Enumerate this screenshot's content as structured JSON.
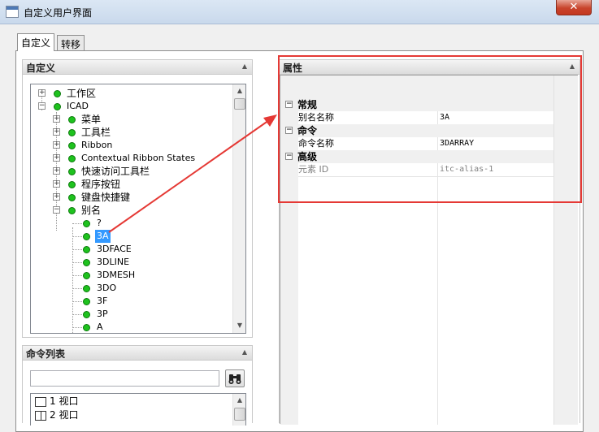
{
  "window": {
    "title": "自定义用户界面",
    "close_glyph": "✕"
  },
  "tabs": [
    {
      "label": "自定义"
    },
    {
      "label": "转移"
    }
  ],
  "customize_panel": {
    "header": "自定义",
    "collapse_glyph": "▲",
    "tree": [
      {
        "label": "工作区"
      },
      {
        "label": "ICAD"
      },
      {
        "label": "菜单"
      },
      {
        "label": "工具栏"
      },
      {
        "label": "Ribbon"
      },
      {
        "label": "Contextual Ribbon States"
      },
      {
        "label": "快速访问工具栏"
      },
      {
        "label": "程序按钮"
      },
      {
        "label": "键盘快捷键"
      },
      {
        "label": "别名"
      },
      {
        "label": "?"
      },
      {
        "label": "3A"
      },
      {
        "label": "3DFACE"
      },
      {
        "label": "3DLINE"
      },
      {
        "label": "3DMESH"
      },
      {
        "label": "3DO"
      },
      {
        "label": "3F"
      },
      {
        "label": "3P"
      },
      {
        "label": "A"
      }
    ]
  },
  "command_list_panel": {
    "header": "命令列表",
    "search_value": "",
    "items": [
      {
        "label": "1 视口"
      },
      {
        "label": "2 视口"
      }
    ]
  },
  "properties_panel": {
    "header": "属性",
    "categories": [
      {
        "name": "常规",
        "rows": [
          {
            "name": "别名名称",
            "value": "3A"
          }
        ]
      },
      {
        "name": "命令",
        "rows": [
          {
            "name": "命令名称",
            "value": "3DARRAY"
          }
        ]
      },
      {
        "name": "高级",
        "rows": [
          {
            "name": "元素 ID",
            "value": "itc-alias-1"
          }
        ]
      }
    ]
  },
  "annotation": {
    "arrow_color": "#e53935",
    "frame_color": "#e53935"
  }
}
